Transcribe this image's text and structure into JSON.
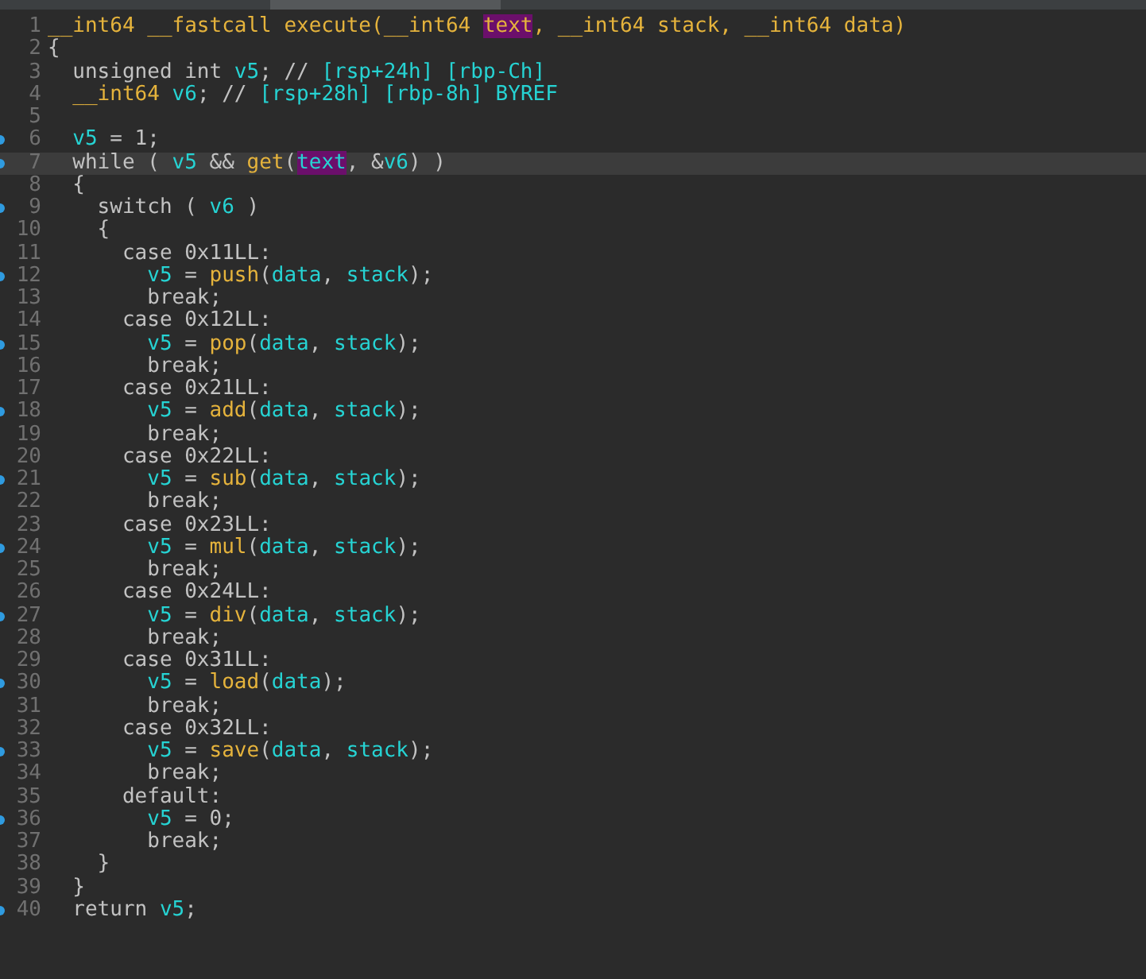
{
  "lines": [
    {
      "number": "1",
      "marker": false,
      "current": false,
      "tokens": [
        {
          "text": "__int64 __fastcall execute(__int64 ",
          "kind": "type",
          "highlighted": false
        },
        {
          "text": "text",
          "kind": "type",
          "highlighted": true
        },
        {
          "text": ", __int64 stack, __int64 data)",
          "kind": "type",
          "highlighted": false
        }
      ]
    },
    {
      "number": "2",
      "marker": false,
      "current": false,
      "tokens": [
        {
          "text": "{",
          "kind": "plain",
          "highlighted": false
        }
      ]
    },
    {
      "number": "3",
      "marker": false,
      "current": false,
      "tokens": [
        {
          "text": "  unsigned int ",
          "kind": "plain",
          "highlighted": false
        },
        {
          "text": "v5",
          "kind": "var",
          "highlighted": false
        },
        {
          "text": "; // ",
          "kind": "plain",
          "highlighted": false
        },
        {
          "text": "[rsp+24h] [rbp-Ch]",
          "kind": "var",
          "highlighted": false
        }
      ]
    },
    {
      "number": "4",
      "marker": false,
      "current": false,
      "tokens": [
        {
          "text": "  __int64 ",
          "kind": "type",
          "highlighted": false
        },
        {
          "text": "v6",
          "kind": "var",
          "highlighted": false
        },
        {
          "text": "; // ",
          "kind": "plain",
          "highlighted": false
        },
        {
          "text": "[rsp+28h] [rbp-8h] BYREF",
          "kind": "var",
          "highlighted": false
        }
      ]
    },
    {
      "number": "5",
      "marker": false,
      "current": false
    },
    {
      "number": "6",
      "marker": true,
      "current": false,
      "tokens": [
        {
          "text": "  v5",
          "kind": "var",
          "highlighted": false
        },
        {
          "text": " = 1;",
          "kind": "plain",
          "highlighted": false
        }
      ]
    },
    {
      "number": "7",
      "marker": true,
      "current": true,
      "tokens": [
        {
          "text": "  while ( ",
          "kind": "plain",
          "highlighted": false
        },
        {
          "text": "v5",
          "kind": "var",
          "highlighted": false
        },
        {
          "text": " && ",
          "kind": "plain",
          "highlighted": false
        },
        {
          "text": "get",
          "kind": "type",
          "highlighted": false
        },
        {
          "text": "(",
          "kind": "plain",
          "highlighted": false
        },
        {
          "text": "text",
          "kind": "var",
          "highlighted": true
        },
        {
          "text": ", &",
          "kind": "plain",
          "highlighted": false
        },
        {
          "text": "v6",
          "kind": "var",
          "highlighted": false
        },
        {
          "text": ") )",
          "kind": "plain",
          "highlighted": false
        }
      ]
    },
    {
      "number": "8",
      "marker": false,
      "current": false,
      "tokens": [
        {
          "text": "  {",
          "kind": "plain",
          "highlighted": false
        }
      ]
    },
    {
      "number": "9",
      "marker": true,
      "current": false,
      "tokens": [
        {
          "text": "    switch ( ",
          "kind": "plain",
          "highlighted": false
        },
        {
          "text": "v6",
          "kind": "var",
          "highlighted": false
        },
        {
          "text": " )",
          "kind": "plain",
          "highlighted": false
        }
      ]
    },
    {
      "number": "10",
      "marker": false,
      "current": false,
      "tokens": [
        {
          "text": "    {",
          "kind": "plain",
          "highlighted": false
        }
      ]
    },
    {
      "number": "11",
      "marker": false,
      "current": false,
      "tokens": [
        {
          "text": "      case 0x11LL:",
          "kind": "plain",
          "highlighted": false
        }
      ]
    },
    {
      "number": "12",
      "marker": true,
      "current": false,
      "tokens": [
        {
          "text": "        v5",
          "kind": "var",
          "highlighted": false
        },
        {
          "text": " = ",
          "kind": "plain",
          "highlighted": false
        },
        {
          "text": "push",
          "kind": "type",
          "highlighted": false
        },
        {
          "text": "(",
          "kind": "plain",
          "highlighted": false
        },
        {
          "text": "data",
          "kind": "var",
          "highlighted": false
        },
        {
          "text": ", ",
          "kind": "plain",
          "highlighted": false
        },
        {
          "text": "stack",
          "kind": "var",
          "highlighted": false
        },
        {
          "text": ");",
          "kind": "plain",
          "highlighted": false
        }
      ]
    },
    {
      "number": "13",
      "marker": false,
      "current": false,
      "tokens": [
        {
          "text": "        break;",
          "kind": "plain",
          "highlighted": false
        }
      ]
    },
    {
      "number": "14",
      "marker": false,
      "current": false,
      "tokens": [
        {
          "text": "      case 0x12LL:",
          "kind": "plain",
          "highlighted": false
        }
      ]
    },
    {
      "number": "15",
      "marker": true,
      "current": false,
      "tokens": [
        {
          "text": "        v5",
          "kind": "var",
          "highlighted": false
        },
        {
          "text": " = ",
          "kind": "plain",
          "highlighted": false
        },
        {
          "text": "pop",
          "kind": "type",
          "highlighted": false
        },
        {
          "text": "(",
          "kind": "plain",
          "highlighted": false
        },
        {
          "text": "data",
          "kind": "var",
          "highlighted": false
        },
        {
          "text": ", ",
          "kind": "plain",
          "highlighted": false
        },
        {
          "text": "stack",
          "kind": "var",
          "highlighted": false
        },
        {
          "text": ");",
          "kind": "plain",
          "highlighted": false
        }
      ]
    },
    {
      "number": "16",
      "marker": false,
      "current": false,
      "tokens": [
        {
          "text": "        break;",
          "kind": "plain",
          "highlighted": false
        }
      ]
    },
    {
      "number": "17",
      "marker": false,
      "current": false,
      "tokens": [
        {
          "text": "      case 0x21LL:",
          "kind": "plain",
          "highlighted": false
        }
      ]
    },
    {
      "number": "18",
      "marker": true,
      "current": false,
      "tokens": [
        {
          "text": "        v5",
          "kind": "var",
          "highlighted": false
        },
        {
          "text": " = ",
          "kind": "plain",
          "highlighted": false
        },
        {
          "text": "add",
          "kind": "type",
          "highlighted": false
        },
        {
          "text": "(",
          "kind": "plain",
          "highlighted": false
        },
        {
          "text": "data",
          "kind": "var",
          "highlighted": false
        },
        {
          "text": ", ",
          "kind": "plain",
          "highlighted": false
        },
        {
          "text": "stack",
          "kind": "var",
          "highlighted": false
        },
        {
          "text": ");",
          "kind": "plain",
          "highlighted": false
        }
      ]
    },
    {
      "number": "19",
      "marker": false,
      "current": false,
      "tokens": [
        {
          "text": "        break;",
          "kind": "plain",
          "highlighted": false
        }
      ]
    },
    {
      "number": "20",
      "marker": false,
      "current": false,
      "tokens": [
        {
          "text": "      case 0x22LL:",
          "kind": "plain",
          "highlighted": false
        }
      ]
    },
    {
      "number": "21",
      "marker": true,
      "current": false,
      "tokens": [
        {
          "text": "        v5",
          "kind": "var",
          "highlighted": false
        },
        {
          "text": " = ",
          "kind": "plain",
          "highlighted": false
        },
        {
          "text": "sub",
          "kind": "type",
          "highlighted": false
        },
        {
          "text": "(",
          "kind": "plain",
          "highlighted": false
        },
        {
          "text": "data",
          "kind": "var",
          "highlighted": false
        },
        {
          "text": ", ",
          "kind": "plain",
          "highlighted": false
        },
        {
          "text": "stack",
          "kind": "var",
          "highlighted": false
        },
        {
          "text": ");",
          "kind": "plain",
          "highlighted": false
        }
      ]
    },
    {
      "number": "22",
      "marker": false,
      "current": false,
      "tokens": [
        {
          "text": "        break;",
          "kind": "plain",
          "highlighted": false
        }
      ]
    },
    {
      "number": "23",
      "marker": false,
      "current": false,
      "tokens": [
        {
          "text": "      case 0x23LL:",
          "kind": "plain",
          "highlighted": false
        }
      ]
    },
    {
      "number": "24",
      "marker": true,
      "current": false,
      "tokens": [
        {
          "text": "        v5",
          "kind": "var",
          "highlighted": false
        },
        {
          "text": " = ",
          "kind": "plain",
          "highlighted": false
        },
        {
          "text": "mul",
          "kind": "type",
          "highlighted": false
        },
        {
          "text": "(",
          "kind": "plain",
          "highlighted": false
        },
        {
          "text": "data",
          "kind": "var",
          "highlighted": false
        },
        {
          "text": ", ",
          "kind": "plain",
          "highlighted": false
        },
        {
          "text": "stack",
          "kind": "var",
          "highlighted": false
        },
        {
          "text": ");",
          "kind": "plain",
          "highlighted": false
        }
      ]
    },
    {
      "number": "25",
      "marker": false,
      "current": false,
      "tokens": [
        {
          "text": "        break;",
          "kind": "plain",
          "highlighted": false
        }
      ]
    },
    {
      "number": "26",
      "marker": false,
      "current": false,
      "tokens": [
        {
          "text": "      case 0x24LL:",
          "kind": "plain",
          "highlighted": false
        }
      ]
    },
    {
      "number": "27",
      "marker": true,
      "current": false,
      "tokens": [
        {
          "text": "        v5",
          "kind": "var",
          "highlighted": false
        },
        {
          "text": " = ",
          "kind": "plain",
          "highlighted": false
        },
        {
          "text": "div",
          "kind": "type",
          "highlighted": false
        },
        {
          "text": "(",
          "kind": "plain",
          "highlighted": false
        },
        {
          "text": "data",
          "kind": "var",
          "highlighted": false
        },
        {
          "text": ", ",
          "kind": "plain",
          "highlighted": false
        },
        {
          "text": "stack",
          "kind": "var",
          "highlighted": false
        },
        {
          "text": ");",
          "kind": "plain",
          "highlighted": false
        }
      ]
    },
    {
      "number": "28",
      "marker": false,
      "current": false,
      "tokens": [
        {
          "text": "        break;",
          "kind": "plain",
          "highlighted": false
        }
      ]
    },
    {
      "number": "29",
      "marker": false,
      "current": false,
      "tokens": [
        {
          "text": "      case 0x31LL:",
          "kind": "plain",
          "highlighted": false
        }
      ]
    },
    {
      "number": "30",
      "marker": true,
      "current": false,
      "tokens": [
        {
          "text": "        v5",
          "kind": "var",
          "highlighted": false
        },
        {
          "text": " = ",
          "kind": "plain",
          "highlighted": false
        },
        {
          "text": "load",
          "kind": "type",
          "highlighted": false
        },
        {
          "text": "(",
          "kind": "plain",
          "highlighted": false
        },
        {
          "text": "data",
          "kind": "var",
          "highlighted": false
        },
        {
          "text": ");",
          "kind": "plain",
          "highlighted": false
        }
      ]
    },
    {
      "number": "31",
      "marker": false,
      "current": false,
      "tokens": [
        {
          "text": "        break;",
          "kind": "plain",
          "highlighted": false
        }
      ]
    },
    {
      "number": "32",
      "marker": false,
      "current": false,
      "tokens": [
        {
          "text": "      case 0x32LL:",
          "kind": "plain",
          "highlighted": false
        }
      ]
    },
    {
      "number": "33",
      "marker": true,
      "current": false,
      "tokens": [
        {
          "text": "        v5",
          "kind": "var",
          "highlighted": false
        },
        {
          "text": " = ",
          "kind": "plain",
          "highlighted": false
        },
        {
          "text": "save",
          "kind": "type",
          "highlighted": false
        },
        {
          "text": "(",
          "kind": "plain",
          "highlighted": false
        },
        {
          "text": "data",
          "kind": "var",
          "highlighted": false
        },
        {
          "text": ", ",
          "kind": "plain",
          "highlighted": false
        },
        {
          "text": "stack",
          "kind": "var",
          "highlighted": false
        },
        {
          "text": ");",
          "kind": "plain",
          "highlighted": false
        }
      ]
    },
    {
      "number": "34",
      "marker": false,
      "current": false,
      "tokens": [
        {
          "text": "        break;",
          "kind": "plain",
          "highlighted": false
        }
      ]
    },
    {
      "number": "35",
      "marker": false,
      "current": false,
      "tokens": [
        {
          "text": "      default:",
          "kind": "plain",
          "highlighted": false
        }
      ]
    },
    {
      "number": "36",
      "marker": true,
      "current": false,
      "tokens": [
        {
          "text": "        v5",
          "kind": "var",
          "highlighted": false
        },
        {
          "text": " = 0;",
          "kind": "plain",
          "highlighted": false
        }
      ]
    },
    {
      "number": "37",
      "marker": false,
      "current": false,
      "tokens": [
        {
          "text": "        break;",
          "kind": "plain",
          "highlighted": false
        }
      ]
    },
    {
      "number": "38",
      "marker": false,
      "current": false,
      "tokens": [
        {
          "text": "    }",
          "kind": "plain",
          "highlighted": false
        }
      ]
    },
    {
      "number": "39",
      "marker": false,
      "current": false,
      "tokens": [
        {
          "text": "  }",
          "kind": "plain",
          "highlighted": false
        }
      ]
    },
    {
      "number": "40",
      "marker": true,
      "current": false,
      "tokens": [
        {
          "text": "  return ",
          "kind": "plain",
          "highlighted": false
        },
        {
          "text": "v5",
          "kind": "var",
          "highlighted": false
        },
        {
          "text": ";",
          "kind": "plain",
          "highlighted": false
        }
      ]
    }
  ]
}
